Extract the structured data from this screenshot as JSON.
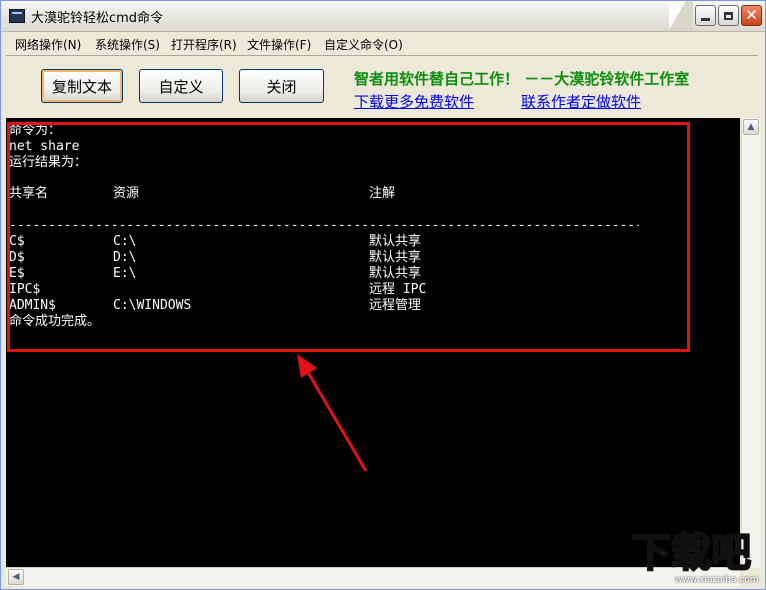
{
  "window": {
    "title": "大漠驼铃轻松cmd命令",
    "controls": {
      "minimize": "minimize-icon",
      "maximize": "maximize-icon",
      "close_glyph": "✕"
    }
  },
  "menu": [
    "网络操作(N)",
    "系统操作(S)",
    "打开程序(R)",
    "文件操作(F)",
    "自定义命令(O)"
  ],
  "toolbar": {
    "copy_label": "复制文本",
    "custom_label": "自定义",
    "close_label": "关闭",
    "slogan": "智者用软件替自己工作！ －－大漠驼铃软件工作室",
    "download_link": "下载更多免费软件",
    "contact_link": "联系作者定做软件"
  },
  "console": {
    "label_command": "命令为：",
    "command": "net share",
    "label_result": "运行结果为：",
    "headers": {
      "share": "共享名",
      "resource": "资源",
      "remark": "注解"
    },
    "separator": "-------------------------------------------------------------------------------------",
    "rows": [
      {
        "share": "C$",
        "resource": "C:\\",
        "remark": "默认共享"
      },
      {
        "share": "D$",
        "resource": "D:\\",
        "remark": "默认共享"
      },
      {
        "share": "E$",
        "resource": "E:\\",
        "remark": "默认共享"
      },
      {
        "share": "IPC$",
        "resource": "",
        "remark": "远程 IPC"
      },
      {
        "share": "ADMIN$",
        "resource": "C:\\WINDOWS",
        "remark": "远程管理"
      }
    ],
    "done": "命令成功完成。"
  },
  "colors": {
    "highlight": "#e11219",
    "arrow": "#e11219",
    "slogan": "#0e8c0e",
    "link": "#0000ee"
  },
  "watermark": {
    "text": "下载吧",
    "url": "www.xiazaiba.com"
  }
}
